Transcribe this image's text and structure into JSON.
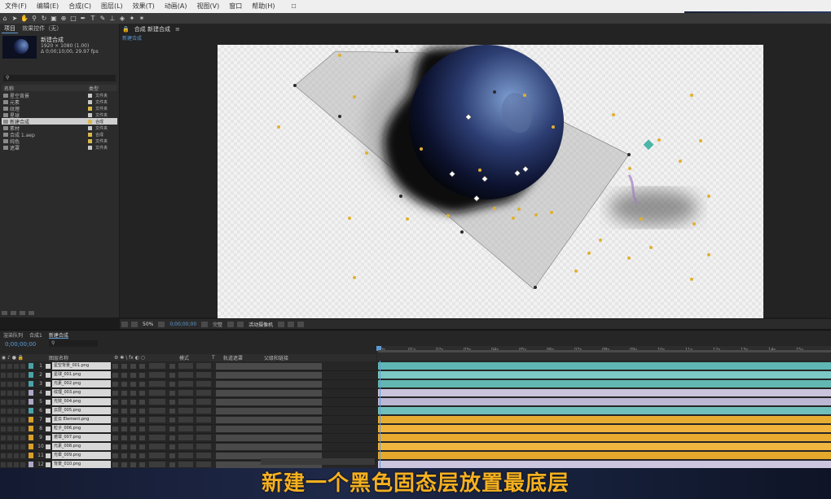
{
  "menu": [
    "文件(F)",
    "编辑(E)",
    "合成(C)",
    "图层(L)",
    "效果(T)",
    "动画(A)",
    "视图(V)",
    "窗口",
    "帮助(H)"
  ],
  "project": {
    "tabs": [
      "项目",
      "效果控件（无）"
    ],
    "comp_name": "新建合成",
    "info_lines": [
      "1920 × 1080 (1.00)",
      "Δ 0;00;10;00, 29.97 fps"
    ],
    "columns": [
      "名称",
      "类型"
    ],
    "items": [
      {
        "name": "星空背景",
        "color": "#c8c8c8",
        "type": "文件夹"
      },
      {
        "name": "元素",
        "color": "#c8c8c8",
        "type": "文件夹"
      },
      {
        "name": "纹理",
        "color": "#d9b84a",
        "type": "文件夹"
      },
      {
        "name": "星球",
        "color": "#c8c8c8",
        "type": "文件夹"
      },
      {
        "name": "新建合成",
        "color": "#d9b84a",
        "type": "合成",
        "selected": true
      },
      {
        "name": "素材",
        "color": "#c8c8c8",
        "type": "文件夹"
      },
      {
        "name": "合成 1.aep",
        "color": "#d9b84a",
        "type": "合成"
      },
      {
        "name": "纯色",
        "color": "#d9b84a",
        "type": "文件夹"
      },
      {
        "name": "遮罩",
        "color": "#c8c8c8",
        "type": "文件夹"
      }
    ]
  },
  "viewer": {
    "tabs": [
      "合成 新建合成"
    ],
    "breadcrumb": [
      "新建合成"
    ],
    "zoom": "50%",
    "timecode": "0;00;00;00",
    "resolution": "完整",
    "camera": "活动摄像机"
  },
  "timeline": {
    "tabs": [
      "渲染队列",
      "合成1",
      "新建合成"
    ],
    "timecode": "0;00;00;00",
    "columns": [
      "图层名称",
      "模式",
      "T",
      "轨道遮罩",
      "父级和链接"
    ],
    "ruler_ticks": [
      "0s",
      "01s",
      "02s",
      "03s",
      "04s",
      "05s",
      "06s",
      "07s",
      "08s",
      "09s",
      "10s",
      "11s",
      "12s",
      "13s",
      "14s",
      "15s"
    ],
    "layers": [
      {
        "num": "1",
        "name": "星空背景_001.png",
        "label": "#4aa3a8",
        "bar": "#5fb6b4"
      },
      {
        "num": "2",
        "name": "星球_001.png",
        "label": "#4aa3a8",
        "bar": "#7cc8c4"
      },
      {
        "num": "3",
        "name": "元素_002.png",
        "label": "#4aa3a8",
        "bar": "#62b7b2"
      },
      {
        "num": "4",
        "name": "纹理_003.png",
        "label": "#b0a8c8",
        "bar": "#c9c4dc"
      },
      {
        "num": "5",
        "name": "光效_004.png",
        "label": "#b0a8c8",
        "bar": "#bcb7d4"
      },
      {
        "num": "6",
        "name": "云层_005.png",
        "label": "#4aa3a8",
        "bar": "#6fbfbb"
      },
      {
        "num": "7",
        "name": "星云 Element.png",
        "label": "#d9a02a",
        "bar": "#e7ad33"
      },
      {
        "num": "8",
        "name": "粒子_006.png",
        "label": "#d9a02a",
        "bar": "#f0b43c"
      },
      {
        "num": "9",
        "name": "遮罩_007.png",
        "label": "#d9a02a",
        "bar": "#e9aa30"
      },
      {
        "num": "10",
        "name": "元素_008.png",
        "label": "#d9a02a",
        "bar": "#f1b640"
      },
      {
        "num": "11",
        "name": "光晕_009.png",
        "label": "#d9a02a",
        "bar": "#e5a82c"
      },
      {
        "num": "12",
        "name": "背景_010.png",
        "label": "#b0a8c8",
        "bar": "#cbc6de"
      }
    ]
  },
  "caption": "新建一个黑色固态层放置最底层",
  "colors": {
    "accent": "#5b9bd5",
    "caption": "#f5b020"
  }
}
